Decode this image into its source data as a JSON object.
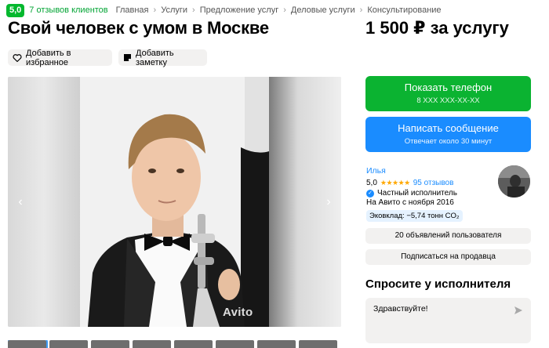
{
  "header": {
    "rating": "5,0",
    "reviews_link": "7 отзывов клиентов",
    "breadcrumbs": [
      "Главная",
      "Услуги",
      "Предложение услуг",
      "Деловые услуги",
      "Консультирование"
    ]
  },
  "listing": {
    "title": "Свой человек с умом в Москве",
    "price": "1 500 ₽ за услугу",
    "favorite_label": "Добавить в избранное",
    "note_label": "Добавить заметку",
    "watermark": "Avito"
  },
  "contact": {
    "phone_label": "Показать телефон",
    "phone_masked": "8 XXX XXX-XX-XX",
    "message_label": "Написать сообщение",
    "message_sub": "Отвечает около 30 минут"
  },
  "seller": {
    "name": "Илья",
    "rating": "5,0",
    "stars": "★★★★★",
    "reviews": "95 отзывов",
    "type": "Частный исполнитель",
    "since": "На Авито с ноября 2016",
    "eco": "Эковклад: −5,74 тонн CO₂",
    "ads_button": "20 объявлений пользователя",
    "subscribe_button": "Подписаться на продавца"
  },
  "ask": {
    "title": "Спросите у исполнителя",
    "message": "Здравствуйте!"
  },
  "colors": {
    "green": "#0bb331",
    "blue": "#1a8cff",
    "badge_green": "#04b82e"
  }
}
